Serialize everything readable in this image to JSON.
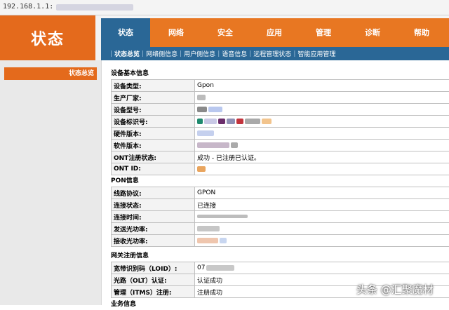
{
  "browser": {
    "url": "192.168.1.1:"
  },
  "brand": {
    "title": "状态"
  },
  "topnav": [
    {
      "label": "状态",
      "active": true
    },
    {
      "label": "网络",
      "active": false
    },
    {
      "label": "安全",
      "active": false
    },
    {
      "label": "应用",
      "active": false
    },
    {
      "label": "管理",
      "active": false
    },
    {
      "label": "诊断",
      "active": false
    },
    {
      "label": "帮助",
      "active": false
    }
  ],
  "subnav": [
    {
      "label": "状态总览",
      "active": true
    },
    {
      "label": "网络侧信息",
      "active": false
    },
    {
      "label": "用户侧信息",
      "active": false
    },
    {
      "label": "语音信息",
      "active": false
    },
    {
      "label": "远程管理状态",
      "active": false
    },
    {
      "label": "智能应用管理",
      "active": false
    }
  ],
  "sidebar": {
    "active_item": "状态总览"
  },
  "device": {
    "title": "设备基本信息",
    "rows": [
      {
        "label": "设备类型:",
        "value": "Gpon"
      },
      {
        "label": "生产厂家:",
        "value": ""
      },
      {
        "label": "设备型号:",
        "value": ""
      },
      {
        "label": "设备标识号:",
        "value": ""
      },
      {
        "label": "硬件版本:",
        "value": ""
      },
      {
        "label": "软件版本:",
        "value": ""
      },
      {
        "label": "ONT注册状态:",
        "value": "成功 - 已注册已认证。"
      },
      {
        "label": "ONT ID:",
        "value": ""
      }
    ]
  },
  "pon": {
    "title": "PON信息",
    "rows": [
      {
        "label": "线路协议:",
        "value": "GPON"
      },
      {
        "label": "连接状态:",
        "value": "已连接"
      },
      {
        "label": "连接时间:",
        "value": ""
      },
      {
        "label": "发送光功率:",
        "value": ""
      },
      {
        "label": "接收光功率:",
        "value": ""
      }
    ]
  },
  "gateway": {
    "title": "网关注册信息",
    "rows": [
      {
        "label": "宽带识别码（LOID）:",
        "value": "07"
      },
      {
        "label": "光路（OLT）认证:",
        "value": "认证成功"
      },
      {
        "label": "管理（ITMS）注册:",
        "value": "注册成功"
      }
    ]
  },
  "business": {
    "title": "业务信息"
  },
  "watermark": {
    "text": "头条 @汇聚魔材"
  },
  "colors": {
    "accent_orange": "#e87722",
    "brand_orange": "#e46a1c",
    "nav_blue": "#2a6796"
  }
}
